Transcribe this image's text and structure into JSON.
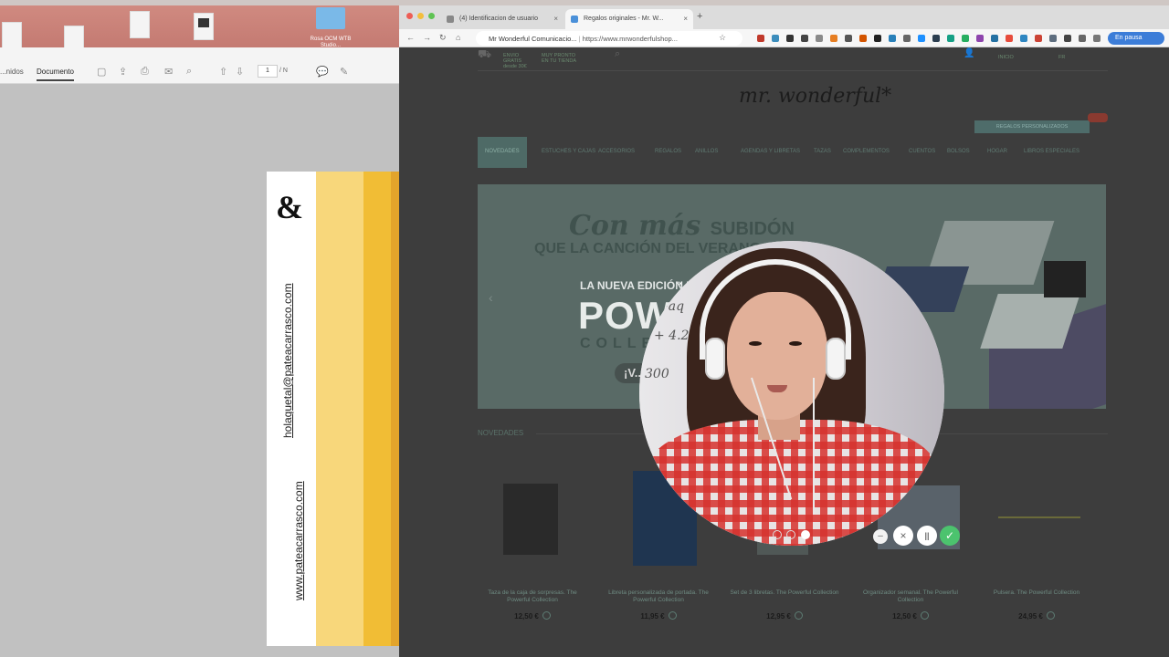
{
  "pdf_viewer": {
    "tabs": [
      "...nidos",
      "Documento"
    ],
    "page_current": "1",
    "page_total": "/ N",
    "folder_label": "Rosa OCM WTB Studio...",
    "page_content": {
      "ampersand": "&",
      "email": "holaquetal@pateacarrasco.com",
      "website": "www.pateacarrasco.com"
    }
  },
  "browser": {
    "tabs": [
      {
        "label": "(4) Identificacion de usuario"
      },
      {
        "label": "Regalos originales - Mr. W..."
      }
    ],
    "site_name": "Mr Wonderful Comunicacio...",
    "url": "https://www.mrwonderfulshop...",
    "profile_label": "En pausa",
    "colors": {
      "accent": "#4e6a66",
      "price": "#1a1a1a",
      "check": "#4cc36e"
    }
  },
  "site": {
    "logo": "mr. wonderful*",
    "top_items": [
      "ENVIO GRATIS desde 30€",
      "MUY PRONTO EN TU TIENDA",
      "INICIO",
      "FR"
    ],
    "promo": "REGALOS PERSONALIZADOS",
    "nav": [
      "NOVEDADES",
      "ESTUCHES Y CAJAS",
      "ACCESORIOS",
      "REGALOS",
      "ANILLOS",
      "AGENDAS Y LIBRETAS",
      "TAZAS",
      "COMPLEMENTOS",
      "CUENTOS",
      "BOLSOS",
      "HOGAR",
      "LIBROS ESPECIALES"
    ],
    "hero": {
      "line1": "Con más",
      "line1b": "SUBIDÓN",
      "line2": "QUE LA CANCIÓN DEL VERANO LLEGA",
      "line3": "LA NUEVA EDICIÓN LIM...",
      "line4": "POWERF...",
      "line5": "COLLE...",
      "button": "¡V..."
    },
    "section_title": "NOVEDADES",
    "products": [
      {
        "name": "Taza de la caja de sorpresas. The Powerful Collection",
        "price": "12,50 €"
      },
      {
        "name": "Libreta personalizada de portada. The Powerful Collection",
        "price": "11,95 €"
      },
      {
        "name": "Set de 3 libretas. The Powerful Collection",
        "price": "12,95 €"
      },
      {
        "name": "Organizador semanal. The Powerful Collection",
        "price": "12,50 €"
      },
      {
        "name": "Pulsera. The Powerful Collection",
        "price": "24,95 €"
      }
    ]
  },
  "webcam": {
    "board_text": [
      "+aq",
      "+ 4.2",
      "300"
    ],
    "close": "×",
    "controls": {
      "minimize": "–",
      "cancel": "×",
      "pause": "||",
      "done": "✓"
    }
  }
}
